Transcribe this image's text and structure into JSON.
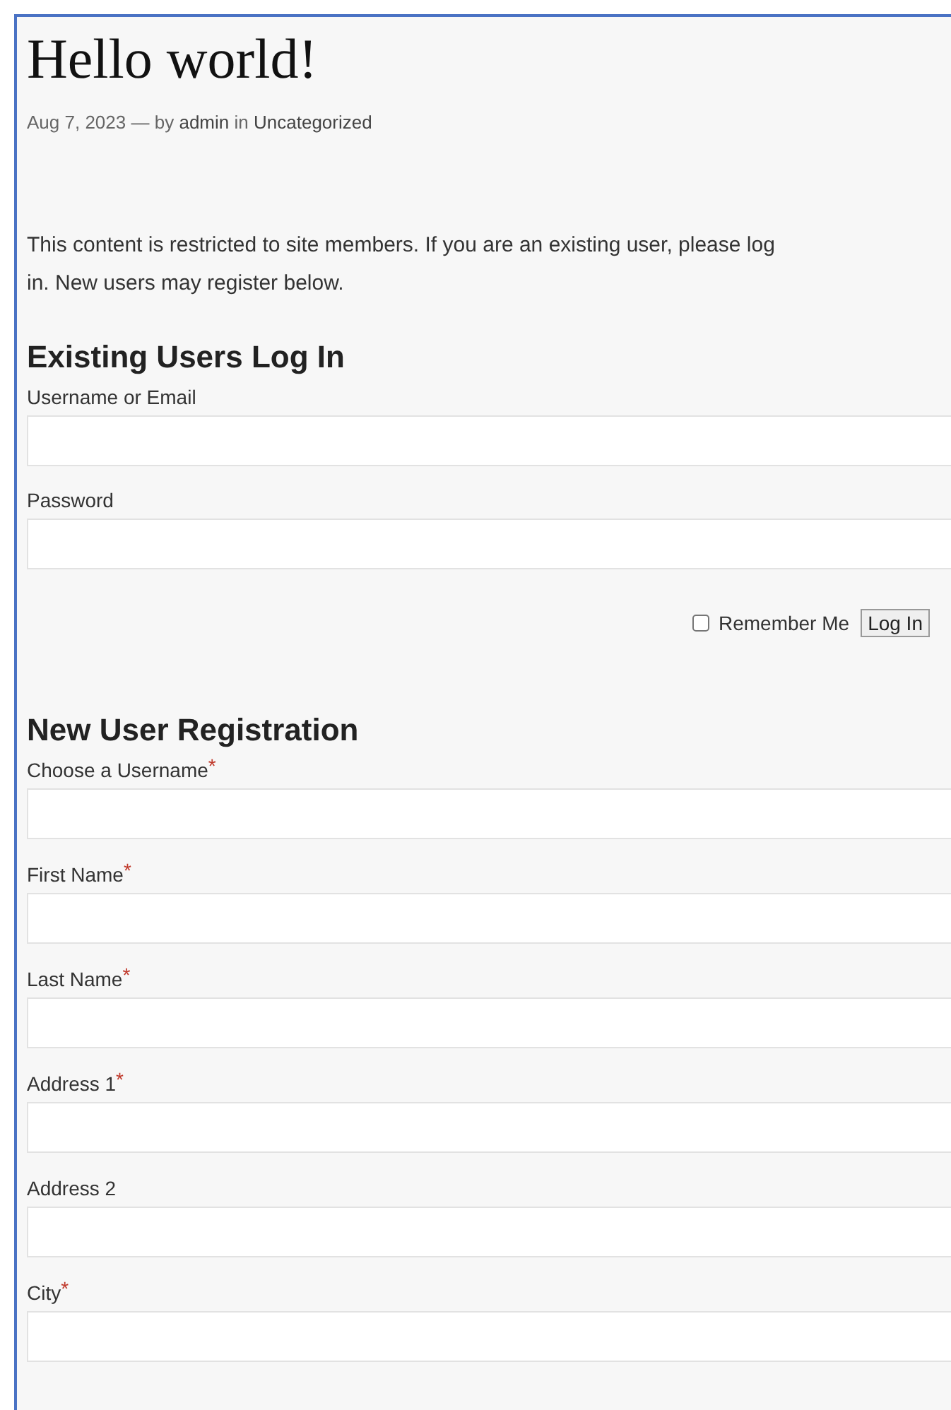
{
  "post": {
    "title": "Hello world!",
    "date": "Aug 7, 2023",
    "separator": "— by",
    "author": "admin",
    "in_word": "in",
    "category": "Uncategorized"
  },
  "notice": "This content is restricted to site members. If you are an existing user, please log in. New users may register below.",
  "required_marker": "*",
  "login": {
    "heading": "Existing Users Log In",
    "fields": [
      {
        "label": "Username or Email",
        "required": false
      },
      {
        "label": "Password",
        "required": false
      }
    ],
    "remember": {
      "label": "Remember Me",
      "checked": false
    },
    "button": "Log In"
  },
  "registration": {
    "heading": "New User Registration",
    "fields": [
      {
        "label": "Choose a Username",
        "required": true
      },
      {
        "label": "First Name",
        "required": true
      },
      {
        "label": "Last Name",
        "required": true
      },
      {
        "label": "Address 1",
        "required": true
      },
      {
        "label": "Address 2",
        "required": false
      },
      {
        "label": "City",
        "required": true
      }
    ]
  }
}
